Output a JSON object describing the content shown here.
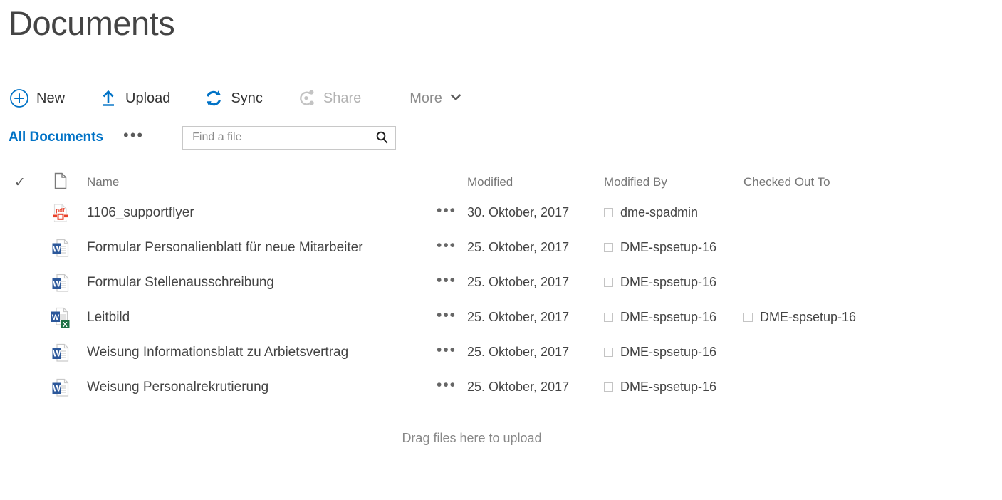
{
  "page": {
    "title": "Documents",
    "dropzone_text": "Drag files here to upload"
  },
  "toolbar": {
    "new_label": "New",
    "upload_label": "Upload",
    "sync_label": "Sync",
    "share_label": "Share",
    "more_label": "More",
    "new_icon": "circle-plus-icon",
    "upload_icon": "upload-arrow-icon",
    "sync_icon": "sync-arrows-icon",
    "share_icon": "share-people-icon",
    "more_icon": "chevron-down-icon",
    "accent_color": "#0072c6",
    "disabled_color": "#b3b3b3"
  },
  "viewbar": {
    "view_name": "All Documents",
    "ellipsis": "•••",
    "search_placeholder": "Find a file",
    "search_value": "",
    "search_icon": "search-icon"
  },
  "table": {
    "columns": {
      "select": "✓",
      "type": "document-type-icon",
      "name": "Name",
      "modified": "Modified",
      "modified_by": "Modified By",
      "checked_out_to": "Checked Out To"
    },
    "row_menu": "•••",
    "rows": [
      {
        "icon": "pdf-file-icon",
        "name": "1106_supportflyer",
        "modified": "30. Oktober, 2017",
        "modified_by": "dme-spadmin",
        "checked_out_to": ""
      },
      {
        "icon": "word-file-icon",
        "name": "Formular Personalienblatt für neue Mitarbeiter",
        "modified": "25. Oktober, 2017",
        "modified_by": "DME-spsetup-16",
        "checked_out_to": ""
      },
      {
        "icon": "word-file-icon",
        "name": "Formular Stellenausschreibung",
        "modified": "25. Oktober, 2017",
        "modified_by": "DME-spsetup-16",
        "checked_out_to": ""
      },
      {
        "icon": "word-file-checked-out-icon",
        "name": "Leitbild",
        "modified": "25. Oktober, 2017",
        "modified_by": "DME-spsetup-16",
        "checked_out_to": "DME-spsetup-16"
      },
      {
        "icon": "word-file-icon",
        "name": "Weisung Informationsblatt zu Arbietsvertrag",
        "modified": "25. Oktober, 2017",
        "modified_by": "DME-spsetup-16",
        "checked_out_to": ""
      },
      {
        "icon": "word-file-icon",
        "name": "Weisung Personalrekrutierung",
        "modified": "25. Oktober, 2017",
        "modified_by": "DME-spsetup-16",
        "checked_out_to": ""
      }
    ]
  }
}
